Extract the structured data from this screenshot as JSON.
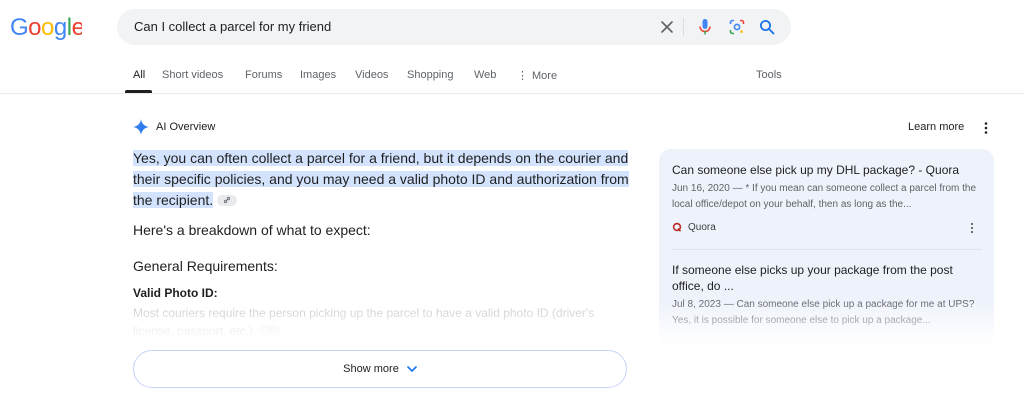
{
  "search": {
    "query": "Can I collect a parcel for my friend"
  },
  "tabs": [
    {
      "label": "All"
    },
    {
      "label": "Short videos"
    },
    {
      "label": "Forums"
    },
    {
      "label": "Images"
    },
    {
      "label": "Videos"
    },
    {
      "label": "Shopping"
    },
    {
      "label": "Web"
    },
    {
      "label": "More"
    }
  ],
  "tools_label": "Tools",
  "ai_overview": {
    "title": "AI Overview",
    "learn_more": "Learn more",
    "summary": "Yes, you can often collect a parcel for a friend, but it depends on the courier and their specific policies, and you may need a valid photo ID and authorization from the recipient.",
    "breakdown": "Here's a breakdown of what to expect:",
    "general_heading": "General Requirements:",
    "photo_heading": "Valid Photo ID:",
    "photo_text": "Most couriers require the person picking up the parcel to have a valid photo ID (driver's license, passport, etc.).",
    "show_more": "Show more"
  },
  "sources": [
    {
      "title": "Can someone else pick up my DHL package? - Quora",
      "snippet": "Jun 16, 2020 — * If you mean can someone collect a parcel from the local office/depot on your behalf, then as long as the...",
      "site": "Quora"
    },
    {
      "title": "If someone else picks up your package from the post office, do ...",
      "snippet": "Jul 8, 2023 — Can someone else pick up a package for me at UPS? Yes, it is possible for someone else to pick up a package..."
    }
  ],
  "colors": {
    "accent_blue": "#1a73e8",
    "highlight": "#d3e3fd",
    "quora_red": "#b92b27"
  }
}
